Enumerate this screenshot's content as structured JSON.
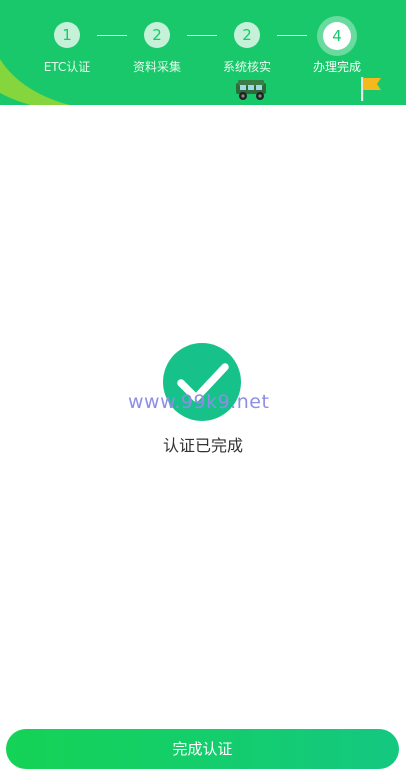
{
  "steps": [
    {
      "number": "1",
      "label": "ETC认证"
    },
    {
      "number": "2",
      "label": "资料采集"
    },
    {
      "number": "2",
      "label": "系统核实"
    },
    {
      "number": "4",
      "label": "办理完成"
    }
  ],
  "icons": {
    "truck": "truck-icon",
    "flag": "flag-icon",
    "success": "checkmark-icon"
  },
  "colors": {
    "header": "#19c86a",
    "success": "#16c28a",
    "flag": "#f5b81d"
  },
  "watermark": "www.99k9.net",
  "status_text": "认证已完成",
  "complete_button": "完成认证"
}
